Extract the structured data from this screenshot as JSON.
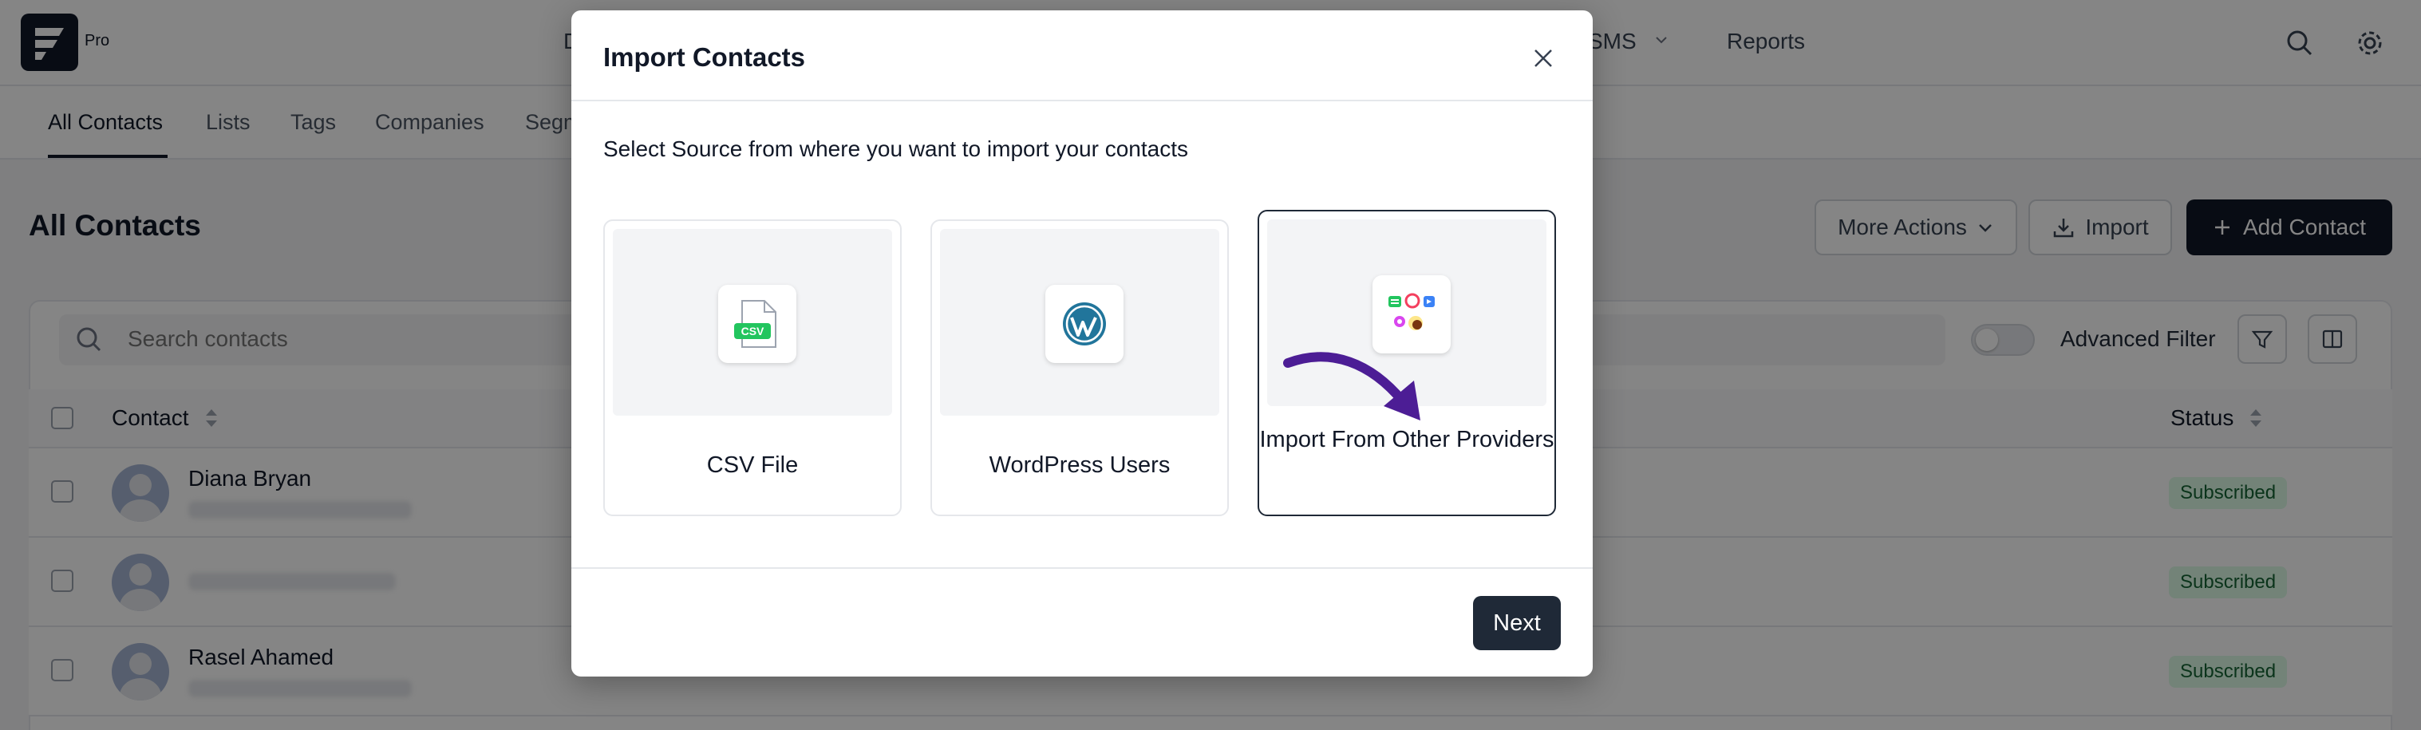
{
  "app": {
    "badge": "Pro",
    "nav": [
      {
        "label": "D"
      },
      {
        "label": "SMS"
      },
      {
        "label": "Reports"
      }
    ]
  },
  "subnav": {
    "tabs": [
      {
        "label": "All Contacts"
      },
      {
        "label": "Lists"
      },
      {
        "label": "Tags"
      },
      {
        "label": "Companies"
      },
      {
        "label": "Segm"
      }
    ]
  },
  "page": {
    "title": "All Contacts",
    "more_actions": "More Actions",
    "import": "Import",
    "add_contact": "Add Contact"
  },
  "filters": {
    "search_placeholder": "Search contacts",
    "advanced_filter": "Advanced Filter"
  },
  "table": {
    "headers": {
      "contact": "Contact",
      "status": "Status"
    },
    "rows": [
      {
        "name": "Diana Bryan",
        "status": "Subscribed"
      },
      {
        "name": "",
        "status": "Subscribed"
      },
      {
        "name": "Rasel Ahamed",
        "status": "Subscribed"
      }
    ]
  },
  "modal": {
    "title": "Import Contacts",
    "subtitle": "Select Source from where you want to import your contacts",
    "sources": [
      {
        "label": "CSV File",
        "icon": "csv-file-icon",
        "badge": "CSV"
      },
      {
        "label": "WordPress Users",
        "icon": "wordpress-icon"
      },
      {
        "label": "Import From Other Providers",
        "icon": "providers-icon"
      }
    ],
    "selected_source": "Import From Other Providers",
    "next": "Next"
  },
  "colors": {
    "primary": "#1f2937",
    "csv_green": "#22c55e",
    "wordpress_blue": "#21759b",
    "arrow_purple": "#4c1d95",
    "badge_green": "#dcfce7"
  }
}
